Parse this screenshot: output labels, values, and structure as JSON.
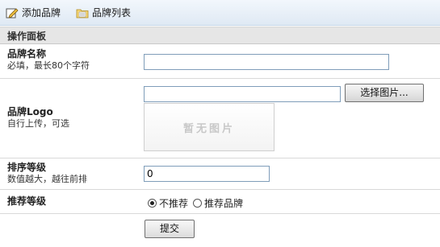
{
  "toolbar": {
    "add_brand": "添加品牌",
    "brand_list": "品牌列表"
  },
  "panel": {
    "title": "操作面板"
  },
  "fields": {
    "name": {
      "label": "品牌名称",
      "hint": "必填，最长80个字符",
      "value": ""
    },
    "logo": {
      "label": "品牌Logo",
      "hint": "自行上传，可选",
      "value": "",
      "button": "选择图片...",
      "placeholder_image": "暂无图片"
    },
    "order": {
      "label": "排序等级",
      "hint": "数值越大，越往前排",
      "value": "0"
    },
    "recommend": {
      "label": "推荐等级",
      "options": [
        "不推荐",
        "推荐品牌"
      ],
      "selected": "不推荐"
    }
  },
  "submit": "提交",
  "colors": {
    "toolbar_bg": "#dfe9f4",
    "panel_header_bg": "#e6e6e6",
    "input_border": "#7f9db9"
  },
  "icons": {
    "add_brand": "pencil-edit-icon",
    "brand_list": "folder-list-icon"
  }
}
